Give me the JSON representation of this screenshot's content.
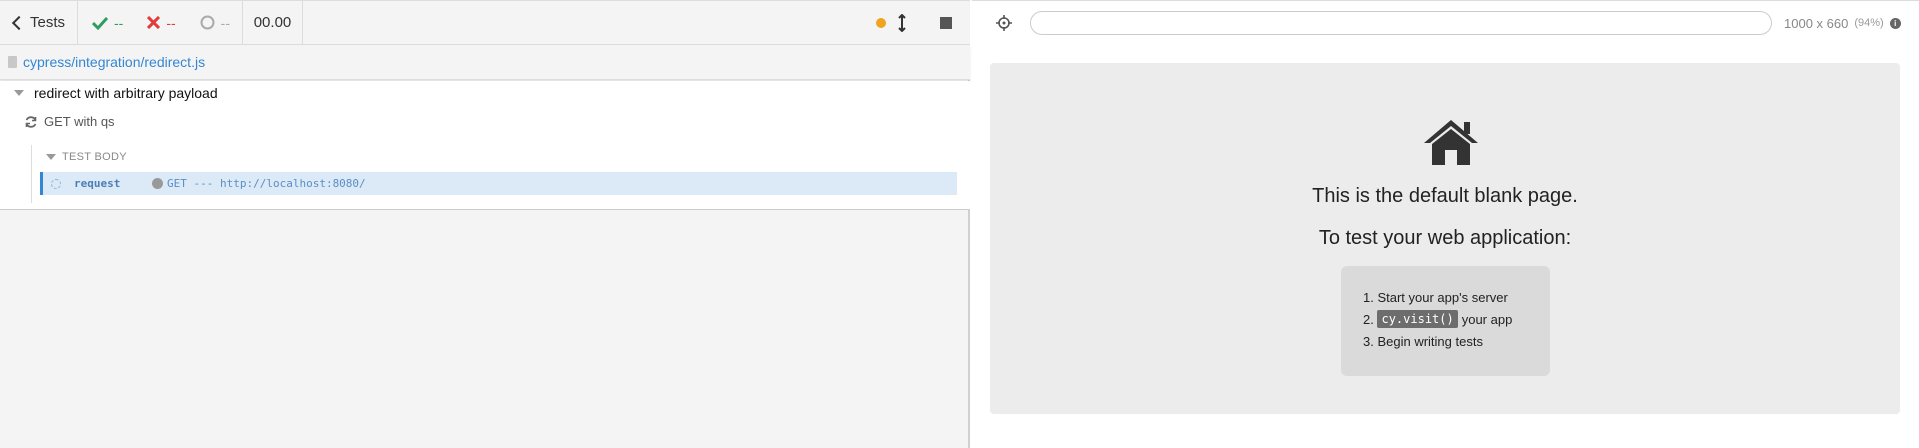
{
  "reporter": {
    "tests_label": "Tests",
    "stats": {
      "passed": "--",
      "failed": "--",
      "pending": "--"
    },
    "duration": "00.00",
    "spec_path": "cypress/integration/redirect.js",
    "suite_title": "redirect with arbitrary payload",
    "test_title": "GET with qs",
    "hook_title": "TEST BODY",
    "command": {
      "name": "request",
      "message": "GET --- http://localhost:8080/"
    },
    "colors": {
      "passed": "#2e9d5d",
      "failed": "#e23b3b",
      "running": "#f0a31d",
      "link": "#3386d4"
    }
  },
  "aut": {
    "url_value": "",
    "viewport": "1000 x 660",
    "scale": "(94%)",
    "blank_title": "This is the default blank page.",
    "blank_sub": "To test your web application:",
    "steps": [
      {
        "num": "1.",
        "text": "Start your app's server"
      },
      {
        "num": "2.",
        "code": "cy.visit()",
        "text": "your app"
      },
      {
        "num": "3.",
        "text": "Begin writing tests"
      }
    ]
  }
}
